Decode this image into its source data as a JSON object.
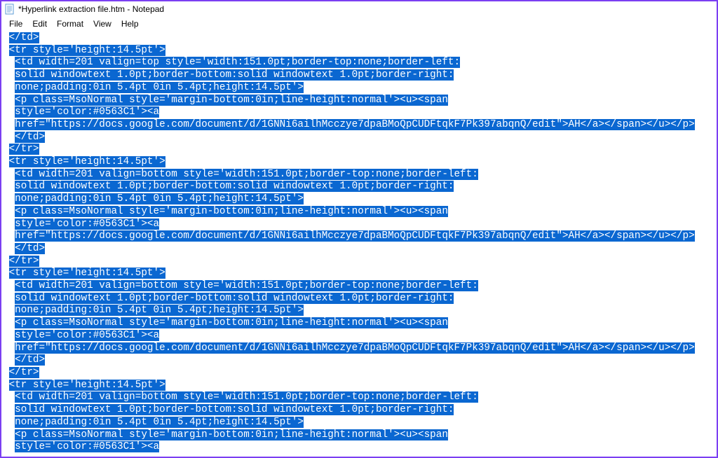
{
  "titlebar": {
    "title": "*Hyperlink extraction file.htm - Notepad"
  },
  "menubar": {
    "file": "File",
    "edit": "Edit",
    "format": "Format",
    "view": "View",
    "help": "Help"
  },
  "editor": {
    "lines": [
      " </td>",
      " <tr style='height:14.5pt'>",
      "  <td width=201 valign=top style='width:151.0pt;border-top:none;border-left:",
      "  solid windowtext 1.0pt;border-bottom:solid windowtext 1.0pt;border-right:",
      "  none;padding:0in 5.4pt 0in 5.4pt;height:14.5pt'>",
      "  <p class=MsoNormal style='margin-bottom:0in;line-height:normal'><u><span",
      "  style='color:#0563C1'><a",
      "  href=\"https://docs.google.com/document/d/1GNNi6ailhMcczye7dpaBMoQpCUDFtqkF7Pk397abqnQ/edit\">AH</a></span></u></p>",
      "  </td>",
      " </tr>",
      " <tr style='height:14.5pt'>",
      "  <td width=201 valign=bottom style='width:151.0pt;border-top:none;border-left:",
      "  solid windowtext 1.0pt;border-bottom:solid windowtext 1.0pt;border-right:",
      "  none;padding:0in 5.4pt 0in 5.4pt;height:14.5pt'>",
      "  <p class=MsoNormal style='margin-bottom:0in;line-height:normal'><u><span",
      "  style='color:#0563C1'><a",
      "  href=\"https://docs.google.com/document/d/1GNNi6ailhMcczye7dpaBMoQpCUDFtqkF7Pk397abqnQ/edit\">AH</a></span></u></p>",
      "  </td>",
      " </tr>",
      " <tr style='height:14.5pt'>",
      "  <td width=201 valign=bottom style='width:151.0pt;border-top:none;border-left:",
      "  solid windowtext 1.0pt;border-bottom:solid windowtext 1.0pt;border-right:",
      "  none;padding:0in 5.4pt 0in 5.4pt;height:14.5pt'>",
      "  <p class=MsoNormal style='margin-bottom:0in;line-height:normal'><u><span",
      "  style='color:#0563C1'><a",
      "  href=\"https://docs.google.com/document/d/1GNNi6ailhMcczye7dpaBMoQpCUDFtqkF7Pk397abqnQ/edit\">AH</a></span></u></p>",
      "  </td>",
      " </tr>",
      " <tr style='height:14.5pt'>",
      "  <td width=201 valign=bottom style='width:151.0pt;border-top:none;border-left:",
      "  solid windowtext 1.0pt;border-bottom:solid windowtext 1.0pt;border-right:",
      "  none;padding:0in 5.4pt 0in 5.4pt;height:14.5pt'>",
      "  <p class=MsoNormal style='margin-bottom:0in;line-height:normal'><u><span",
      "  style='color:#0563C1'><a"
    ]
  }
}
